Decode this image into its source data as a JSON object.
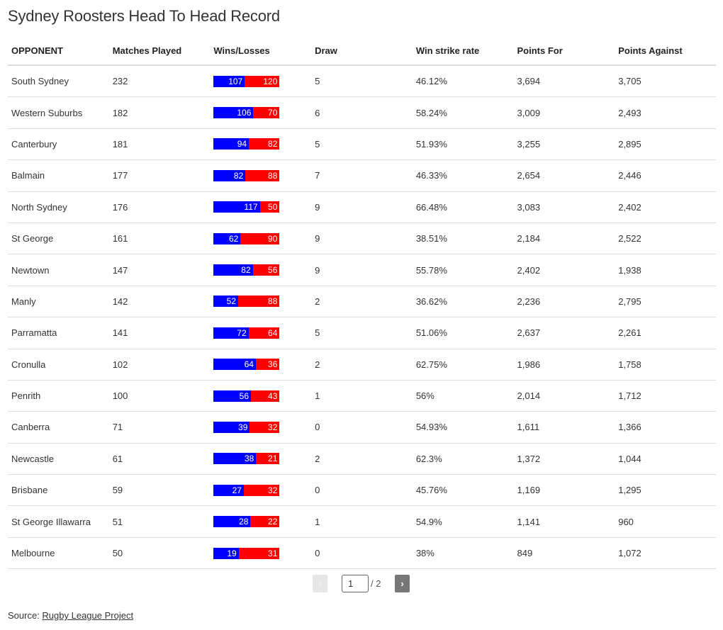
{
  "title": "Sydney Roosters Head To Head Record",
  "colors": {
    "wins": "#0000ff",
    "losses": "#ff0000"
  },
  "chart_data": {
    "type": "table",
    "title": "Sydney Roosters Head To Head Record",
    "columns": [
      "OPPONENT",
      "Matches Played",
      "Wins/Losses",
      "Draw",
      "Win strike rate",
      "Points For",
      "Points Against"
    ],
    "rows": [
      {
        "opponent": "South Sydney",
        "played": "232",
        "wins": 107,
        "losses": 120,
        "draw": "5",
        "rate": "46.12%",
        "pf": "3,694",
        "pa": "3,705"
      },
      {
        "opponent": "Western Suburbs",
        "played": "182",
        "wins": 106,
        "losses": 70,
        "draw": "6",
        "rate": "58.24%",
        "pf": "3,009",
        "pa": "2,493"
      },
      {
        "opponent": "Canterbury",
        "played": "181",
        "wins": 94,
        "losses": 82,
        "draw": "5",
        "rate": "51.93%",
        "pf": "3,255",
        "pa": "2,895"
      },
      {
        "opponent": "Balmain",
        "played": "177",
        "wins": 82,
        "losses": 88,
        "draw": "7",
        "rate": "46.33%",
        "pf": "2,654",
        "pa": "2,446"
      },
      {
        "opponent": "North Sydney",
        "played": "176",
        "wins": 117,
        "losses": 50,
        "draw": "9",
        "rate": "66.48%",
        "pf": "3,083",
        "pa": "2,402"
      },
      {
        "opponent": "St George",
        "played": "161",
        "wins": 62,
        "losses": 90,
        "draw": "9",
        "rate": "38.51%",
        "pf": "2,184",
        "pa": "2,522"
      },
      {
        "opponent": "Newtown",
        "played": "147",
        "wins": 82,
        "losses": 56,
        "draw": "9",
        "rate": "55.78%",
        "pf": "2,402",
        "pa": "1,938"
      },
      {
        "opponent": "Manly",
        "played": "142",
        "wins": 52,
        "losses": 88,
        "draw": "2",
        "rate": "36.62%",
        "pf": "2,236",
        "pa": "2,795"
      },
      {
        "opponent": "Parramatta",
        "played": "141",
        "wins": 72,
        "losses": 64,
        "draw": "5",
        "rate": "51.06%",
        "pf": "2,637",
        "pa": "2,261"
      },
      {
        "opponent": "Cronulla",
        "played": "102",
        "wins": 64,
        "losses": 36,
        "draw": "2",
        "rate": "62.75%",
        "pf": "1,986",
        "pa": "1,758"
      },
      {
        "opponent": "Penrith",
        "played": "100",
        "wins": 56,
        "losses": 43,
        "draw": "1",
        "rate": "56%",
        "pf": "2,014",
        "pa": "1,712"
      },
      {
        "opponent": "Canberra",
        "played": "71",
        "wins": 39,
        "losses": 32,
        "draw": "0",
        "rate": "54.93%",
        "pf": "1,611",
        "pa": "1,366"
      },
      {
        "opponent": "Newcastle",
        "played": "61",
        "wins": 38,
        "losses": 21,
        "draw": "2",
        "rate": "62.3%",
        "pf": "1,372",
        "pa": "1,044"
      },
      {
        "opponent": "Brisbane",
        "played": "59",
        "wins": 27,
        "losses": 32,
        "draw": "0",
        "rate": "45.76%",
        "pf": "1,169",
        "pa": "1,295"
      },
      {
        "opponent": "St George Illawarra",
        "played": "51",
        "wins": 28,
        "losses": 22,
        "draw": "1",
        "rate": "54.9%",
        "pf": "1,141",
        "pa": "960"
      },
      {
        "opponent": "Melbourne",
        "played": "50",
        "wins": 19,
        "losses": 31,
        "draw": "0",
        "rate": "38%",
        "pf": "849",
        "pa": "1,072"
      }
    ]
  },
  "pagination": {
    "prev_label": "‹",
    "next_label": "›",
    "current_page": "1",
    "total_label": "/ 2"
  },
  "footer": {
    "source_prefix": "Source: ",
    "source_link": "Rugby League Project"
  }
}
